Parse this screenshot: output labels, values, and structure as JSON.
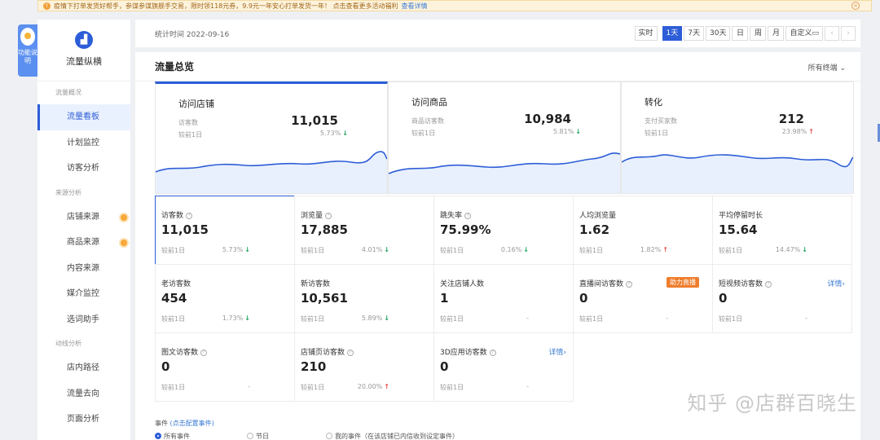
{
  "notice": {
    "text": "疫情下打单发货好帮手，参谋参谋旗舰手交易，限时领118元券，9.9元一年安心打单发货一年！ 点击查看更多活动福利",
    "link": "查看详情"
  },
  "help": {
    "label": "功能说明"
  },
  "sidebar": {
    "app_name": "流量纵横",
    "sections": [
      {
        "title": "流量概况",
        "items": [
          {
            "label": "流量看板"
          },
          {
            "label": "计划监控"
          },
          {
            "label": "访客分析"
          }
        ]
      },
      {
        "title": "来源分析",
        "items": [
          {
            "label": "店铺来源"
          },
          {
            "label": "商品来源"
          },
          {
            "label": "内容来源"
          },
          {
            "label": "媒介监控"
          },
          {
            "label": "选词助手"
          }
        ]
      },
      {
        "title": "动线分析",
        "items": [
          {
            "label": "店内路径"
          },
          {
            "label": "流量去向"
          },
          {
            "label": "页面分析"
          }
        ]
      }
    ]
  },
  "topbar": {
    "stat_time": "统计时间 2022-09-16",
    "periods": [
      "实时",
      "1天",
      "7天",
      "30天",
      "日",
      "周",
      "月",
      "自定义"
    ],
    "active_period": "1天"
  },
  "main": {
    "title": "流量总览",
    "terminal": "所有终端"
  },
  "cards": [
    {
      "name": "访问店铺",
      "sub": "访客数",
      "value": "11,015",
      "cmp": "较前1日",
      "pct": "5.73%",
      "dir": "down"
    },
    {
      "name": "访问商品",
      "sub": "商品访客数",
      "value": "10,984",
      "cmp": "较前1日",
      "pct": "5.81%",
      "dir": "down"
    },
    {
      "name": "转化",
      "sub": "支付买家数",
      "value": "212",
      "cmp": "较前1日",
      "pct": "23.98%",
      "dir": "up"
    }
  ],
  "metrics": [
    {
      "label": "访客数",
      "value": "11,015",
      "cmp": "较前1日",
      "pct": "5.73%",
      "dir": "down"
    },
    {
      "label": "浏览量",
      "value": "17,885",
      "cmp": "较前1日",
      "pct": "4.01%",
      "dir": "down"
    },
    {
      "label": "跳失率",
      "value": "75.99%",
      "cmp": "较前1日",
      "pct": "0.16%",
      "dir": "down"
    },
    {
      "label": "人均浏览量",
      "value": "1.62",
      "cmp": "较前1日",
      "pct": "1.82%",
      "dir": "up"
    },
    {
      "label": "平均停留时长",
      "value": "15.64",
      "cmp": "较前1日",
      "pct": "14.47%",
      "dir": "down"
    },
    {
      "label": "老访客数",
      "value": "454",
      "cmp": "较前1日",
      "pct": "1.73%",
      "dir": "down"
    },
    {
      "label": "新访客数",
      "value": "10,561",
      "cmp": "较前1日",
      "pct": "5.89%",
      "dir": "down"
    },
    {
      "label": "关注店铺人数",
      "value": "1",
      "cmp": "较前1日",
      "pct": "-",
      "dir": ""
    },
    {
      "label": "直播间访客数",
      "value": "0",
      "cmp": "较前1日",
      "pct": "-",
      "dir": "",
      "badge": "助力直播"
    },
    {
      "label": "短视频访客数",
      "value": "0",
      "cmp": "较前1日",
      "pct": "-",
      "dir": "",
      "detail": "详情"
    },
    {
      "label": "图文访客数",
      "value": "0",
      "cmp": "较前1日",
      "pct": "-",
      "dir": ""
    },
    {
      "label": "店铺页访客数",
      "value": "210",
      "cmp": "较前1日",
      "pct": "20.00%",
      "dir": "up"
    },
    {
      "label": "3D应用访客数",
      "value": "0",
      "cmp": "较前1日",
      "pct": "-",
      "dir": "",
      "detail": "详情"
    }
  ],
  "events": {
    "label": "事件",
    "config": "(点击配置事件)",
    "options": [
      "所有事件",
      "节日",
      "我的事件（在该店铺已内信收到设定事件）"
    ]
  },
  "watermark": "知乎 @店群百晓生",
  "colors": {
    "accent": "#2d5dd7",
    "down": "#1aa25e",
    "up": "#e54b4b",
    "badge": "#ef7d2c"
  }
}
